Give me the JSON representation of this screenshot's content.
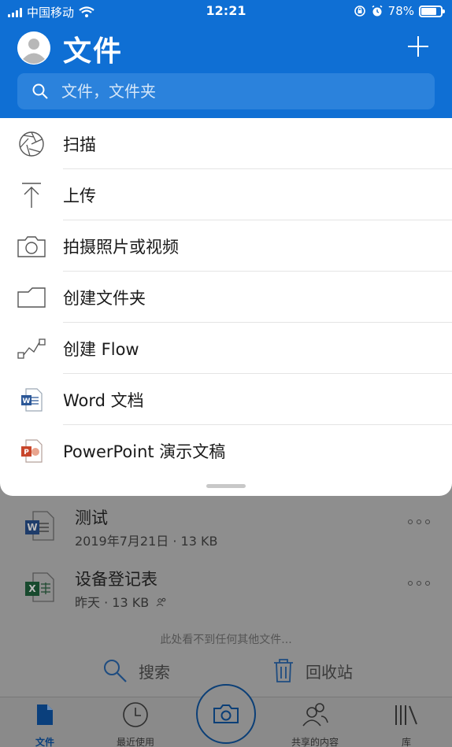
{
  "status_bar": {
    "carrier": "中国移动",
    "time": "12:21",
    "battery": "78%",
    "battery_level": 0.78
  },
  "header": {
    "title": "文件",
    "search_placeholder": "文件，文件夹"
  },
  "menu": [
    {
      "label": "扫描",
      "icon": "aperture-icon"
    },
    {
      "label": "上传",
      "icon": "upload-icon"
    },
    {
      "label": "拍摄照片或视频",
      "icon": "camera-icon"
    },
    {
      "label": "创建文件夹",
      "icon": "folder-icon"
    },
    {
      "label": "创建 Flow",
      "icon": "flow-icon"
    },
    {
      "label": "Word 文档",
      "icon": "word-icon"
    },
    {
      "label": "PowerPoint 演示文稿",
      "icon": "powerpoint-icon"
    }
  ],
  "files": [
    {
      "name": "测试",
      "meta": "2019年7月21日 · 13 KB",
      "icon": "word-icon"
    },
    {
      "name": "设备登记表",
      "meta": "昨天 · 13 KB",
      "icon": "excel-icon",
      "shared": true
    }
  ],
  "hint": "此处看不到任何其他文件...",
  "actions": {
    "search": "搜索",
    "recycle": "回收站"
  },
  "tabs": [
    {
      "label": "文件",
      "active": true
    },
    {
      "label": "最近使用"
    },
    {
      "label": "共享的内容"
    },
    {
      "label": "库"
    }
  ],
  "colors": {
    "brand": "#0f6fd4",
    "word": "#2b5797",
    "excel": "#1e7145",
    "powerpoint": "#c8462b"
  }
}
